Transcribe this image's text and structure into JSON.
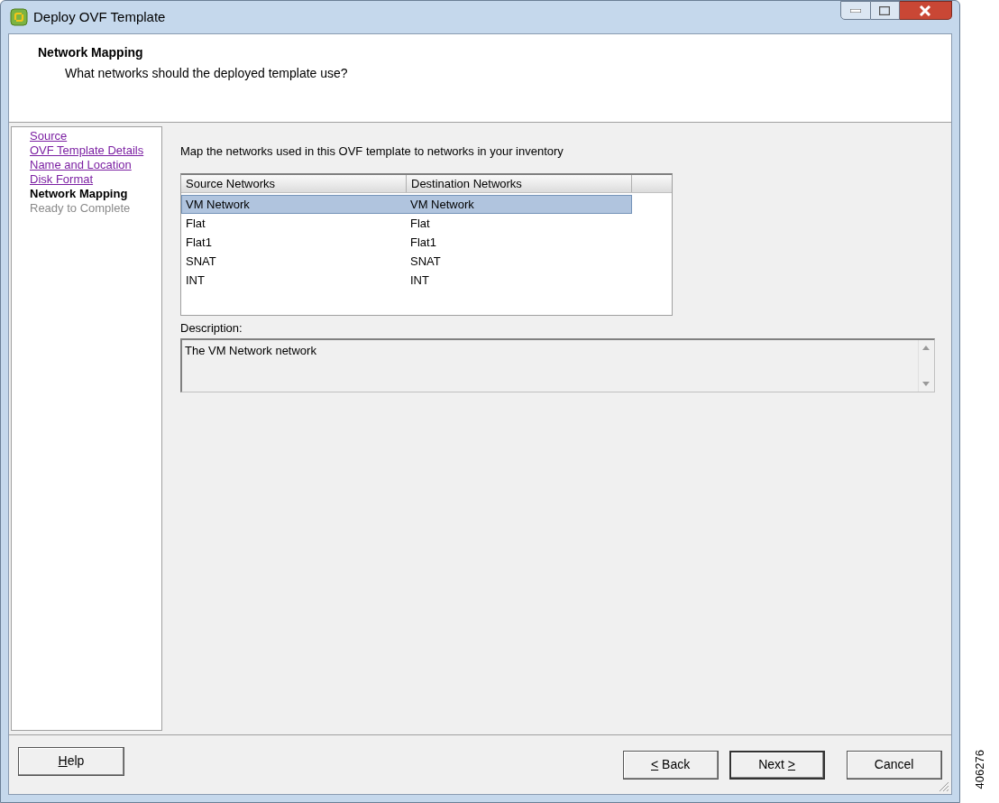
{
  "window": {
    "title": "Deploy OVF Template"
  },
  "header": {
    "title": "Network Mapping",
    "subtitle": "What networks should the deployed template use?"
  },
  "steps": [
    {
      "label": "Source",
      "kind": "visited"
    },
    {
      "label": "OVF Template Details",
      "kind": "visited"
    },
    {
      "label": "Name and Location",
      "kind": "visited"
    },
    {
      "label": "Disk Format",
      "kind": "visited"
    },
    {
      "label": "Network Mapping",
      "kind": "current"
    },
    {
      "label": "Ready to Complete",
      "kind": "pending"
    }
  ],
  "instruction": "Map the networks used in this OVF template to networks in your inventory",
  "table": {
    "columns": [
      "Source Networks",
      "Destination Networks"
    ],
    "rows": [
      {
        "cells": [
          "VM Network",
          "VM Network"
        ],
        "selected": true
      },
      {
        "cells": [
          "Flat",
          "Flat"
        ],
        "selected": false
      },
      {
        "cells": [
          "Flat1",
          "Flat1"
        ],
        "selected": false
      },
      {
        "cells": [
          "SNAT",
          "SNAT"
        ],
        "selected": false
      },
      {
        "cells": [
          "INT",
          "INT"
        ],
        "selected": false
      }
    ]
  },
  "description": {
    "label": "Description:",
    "text": "The VM Network network"
  },
  "buttons": [
    {
      "label": "Help",
      "underline_first": true,
      "underline_last": false,
      "default": false
    },
    {
      "label": "< Back",
      "underline_first": true,
      "underline_last": false,
      "default": false
    },
    {
      "label": "Next >",
      "underline_first": false,
      "underline_last": true,
      "default": true
    },
    {
      "label": "Cancel",
      "underline_first": false,
      "underline_last": false,
      "default": false
    }
  ],
  "figure_number": "406276"
}
